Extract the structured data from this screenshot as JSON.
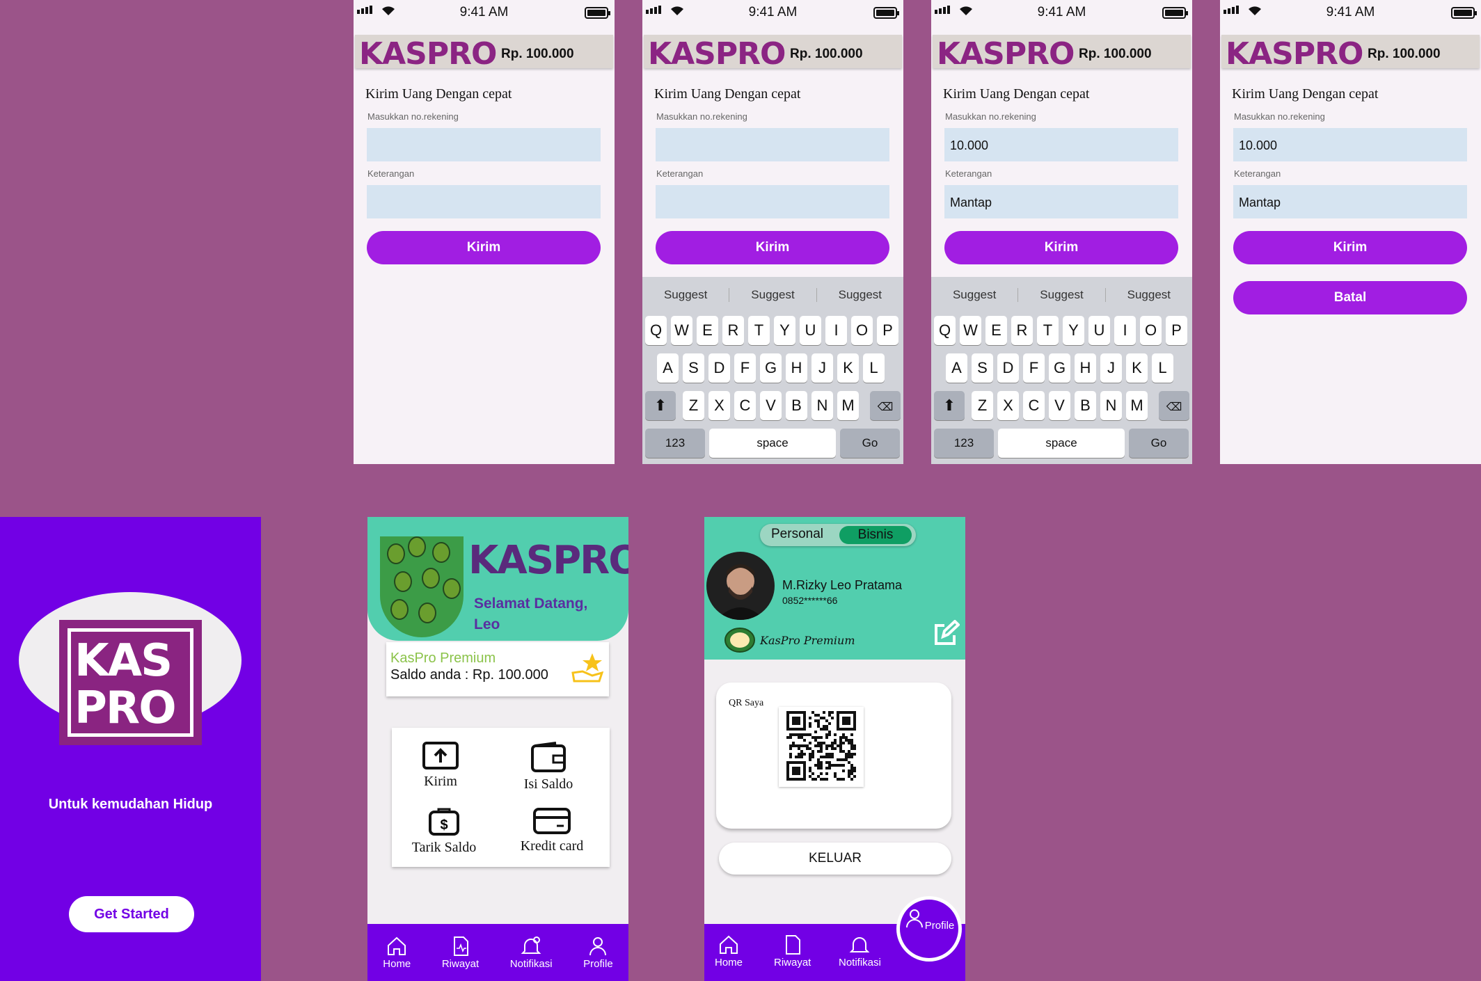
{
  "status": {
    "time": "9:41 AM"
  },
  "brand": {
    "logo": "KASPRO",
    "accent": "#A11EE2",
    "header_purple": "#7200E5",
    "mint": "#52CEAE"
  },
  "transfer_screens": [
    {
      "balance": "Rp. 100.000",
      "title": "Kirim Uang Dengan cepat",
      "account_label": "Masukkan no.rekening",
      "account_value": "",
      "note_label": "Keterangan",
      "note_value": "",
      "send_label": "Kirim"
    },
    {
      "balance": "Rp. 100.000",
      "title": "Kirim Uang Dengan cepat",
      "account_label": "Masukkan no.rekening",
      "account_value": "",
      "note_label": "Keterangan",
      "note_value": "",
      "send_label": "Kirim"
    },
    {
      "balance": "Rp. 100.000",
      "title": "Kirim Uang Dengan cepat",
      "account_label": "Masukkan no.rekening",
      "account_value": "10.000",
      "note_label": "Keterangan",
      "note_value": "Mantap",
      "send_label": "Kirim"
    },
    {
      "balance": "Rp. 100.000",
      "title": "Kirim Uang Dengan cepat",
      "account_label": "Masukkan no.rekening",
      "account_value": "10.000",
      "note_label": "Keterangan",
      "note_value": "Mantap",
      "send_label": "Kirim",
      "cancel_label": "Batal"
    }
  ],
  "keyboard": {
    "suggestions": [
      "Suggest",
      "Suggest",
      "Suggest"
    ],
    "row1": [
      "Q",
      "W",
      "E",
      "R",
      "T",
      "Y",
      "U",
      "I",
      "O",
      "P"
    ],
    "row2": [
      "A",
      "S",
      "D",
      "F",
      "G",
      "H",
      "J",
      "K",
      "L"
    ],
    "row3": [
      "Z",
      "X",
      "C",
      "V",
      "B",
      "N",
      "M"
    ],
    "numbers": "123",
    "space": "space",
    "go": "Go"
  },
  "splash": {
    "logo_top": "KAS",
    "logo_bottom": "PRO",
    "tagline": "Untuk kemudahan Hidup",
    "cta": "Get Started"
  },
  "home": {
    "logo": "KASPRO",
    "welcome": "Selamat Datang,",
    "user": "Leo",
    "premium": "KasPro Premium",
    "balance": "Saldo anda : Rp. 100.000",
    "menu": {
      "send": "Kirim",
      "topup": "Isi Saldo",
      "withdraw": "Tarik Saldo",
      "credit": "Kredit card"
    }
  },
  "nav": {
    "home": "Home",
    "history": "Riwayat",
    "notifications": "Notifikasi",
    "profile": "Profile"
  },
  "profile": {
    "tab_personal": "Personal",
    "tab_business": "Bisnis",
    "name": "M.Rizky Leo Pratama",
    "phone": "0852******66",
    "badge": "KasPro Premium",
    "badge_seal": "PREMIUM",
    "qr_label": "QR Saya",
    "logout": "KELUAR"
  }
}
